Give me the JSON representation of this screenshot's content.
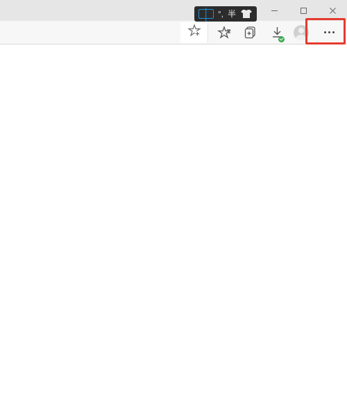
{
  "titleBar": {
    "ime": {
      "punct": "°,",
      "mode": "半"
    },
    "controls": {
      "minimize": "minimize",
      "maximize": "maximize",
      "close": "close"
    }
  },
  "toolbar": {
    "addressFavorite": "add-favorite",
    "favorites": "favorites",
    "collections": "collections",
    "downloads": "downloads",
    "profile": "profile",
    "menu": "settings-and-more"
  },
  "highlight": {
    "target": "menu-button"
  }
}
